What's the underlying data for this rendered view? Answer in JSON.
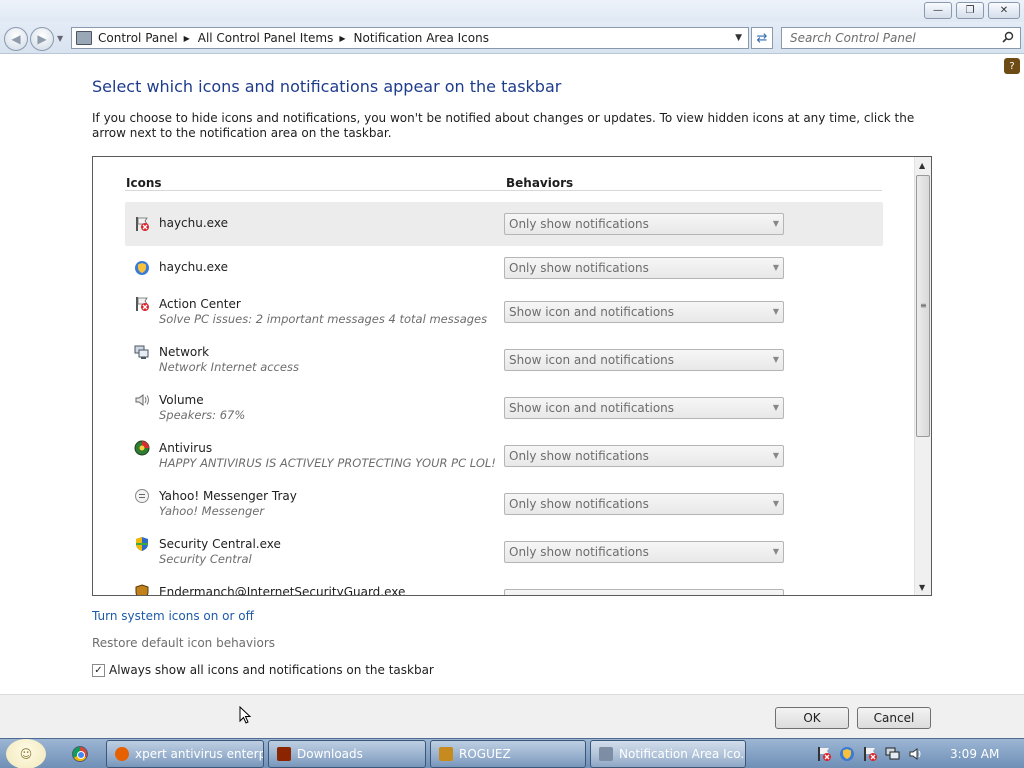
{
  "window": {
    "minimize_glyph": "—",
    "maximize_glyph": "❐",
    "close_glyph": "✕"
  },
  "nav": {
    "breadcrumbs": [
      "Control Panel",
      "All Control Panel Items",
      "Notification Area Icons"
    ],
    "search_placeholder": "Search Control Panel"
  },
  "page": {
    "heading": "Select which icons and notifications appear on the taskbar",
    "description": "If you choose to hide icons and notifications, you won't be notified about changes or updates. To view hidden icons at any time, click the arrow next to the notification area on the taskbar.",
    "col_icons": "Icons",
    "col_behaviors": "Behaviors",
    "rows": [
      {
        "name": "haychu.exe",
        "sub": "",
        "behavior": "Only show notifications",
        "icon": "flag-red-x-icon"
      },
      {
        "name": "haychu.exe",
        "sub": "",
        "behavior": "Only show notifications",
        "icon": "shield-icon"
      },
      {
        "name": "Action Center",
        "sub": "Solve PC issues: 2 important messages  4 total messages",
        "behavior": "Show icon and notifications",
        "icon": "flag-red-x-icon"
      },
      {
        "name": "Network",
        "sub": "Network Internet access",
        "behavior": "Show icon and notifications",
        "icon": "network-icon"
      },
      {
        "name": "Volume",
        "sub": "Speakers: 67%",
        "behavior": "Show icon and notifications",
        "icon": "speaker-icon"
      },
      {
        "name": "Antivirus",
        "sub": "HAPPY ANTIVIRUS IS ACTIVELY PROTECTING YOUR PC LOL!",
        "behavior": "Only show notifications",
        "icon": "antivirus-icon"
      },
      {
        "name": "Yahoo! Messenger Tray",
        "sub": "Yahoo! Messenger",
        "behavior": "Only show notifications",
        "icon": "messenger-icon"
      },
      {
        "name": "Security Central.exe",
        "sub": "Security Central",
        "behavior": "Only show notifications",
        "icon": "security-shield-icon"
      },
      {
        "name": "Endermanch@InternetSecurityGuard.exe",
        "sub": "",
        "behavior": "",
        "icon": "guard-shield-icon"
      }
    ],
    "link_system_icons": "Turn system icons on or off",
    "link_restore": "Restore default icon behaviors",
    "always_show_label": "Always show all icons and notifications on the taskbar",
    "always_show_checked": true,
    "ok_label": "OK",
    "cancel_label": "Cancel"
  },
  "taskbar": {
    "buttons": [
      {
        "label": "xpert antivirus enterp...",
        "icon": "firefox-icon",
        "color": "#e66000"
      },
      {
        "label": "Downloads",
        "icon": "folder-icon",
        "color": "#8b2500"
      },
      {
        "label": "ROGUEZ",
        "icon": "rogue-icon",
        "color": "#c68a1e"
      },
      {
        "label": "Notification Area Ico...",
        "icon": "control-panel-icon",
        "color": "#7d8da3"
      }
    ],
    "clock": "3:09 AM"
  }
}
